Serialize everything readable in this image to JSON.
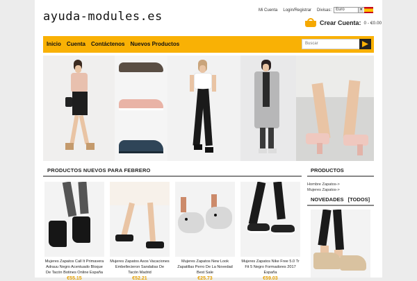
{
  "site": {
    "logo_text": "ayuda-modules.es"
  },
  "top_links": {
    "account": "Mi Cuenta",
    "login": "Login/Registrar",
    "currency_label": "Divisas:",
    "currency_value": "Euro"
  },
  "cart": {
    "title": "Crear Cuenta:",
    "total": "0 - €0.00"
  },
  "nav": {
    "items": [
      "Inicio",
      "Cuenta",
      "Contáctenos",
      "Nuevos Productos"
    ]
  },
  "search": {
    "placeholder": "Buscar"
  },
  "new_products": {
    "heading": "PRODUCTOS NUEVOS PARA FEBRERO",
    "items": [
      {
        "name": "Mujeres Zapatos Call It Primavera Adrauu Negro Acentuado Bloque De Tacón Botines Online España",
        "price": "€55.15"
      },
      {
        "name": "Mujeres Zapatos Asos Vacaciones Embellecieron Sandalias De Tacón Madrid",
        "price": "€52.21"
      },
      {
        "name": "Mujeres Zapatos New Look Zapatillas Perro De La Novedad Best Sale",
        "price": "€25.73"
      },
      {
        "name": "Mujeres Zapatos Nike Free 5.0 Tr Fit 5 Negro Formadores 2017 España",
        "price": "€59.03"
      }
    ]
  },
  "sidebar": {
    "products_heading": "PRODUCTOS",
    "links": [
      "Hombre Zapatos->",
      "Mujeres Zapatos->"
    ],
    "news_heading": "NOVEDADES",
    "news_all": "[TODOS]"
  },
  "colors": {
    "accent": "#f9b105",
    "price": "#e5a000"
  },
  "icons": {
    "cart": "shopping-basket-icon",
    "search": "search-icon",
    "flag": "spain-flag-icon"
  }
}
